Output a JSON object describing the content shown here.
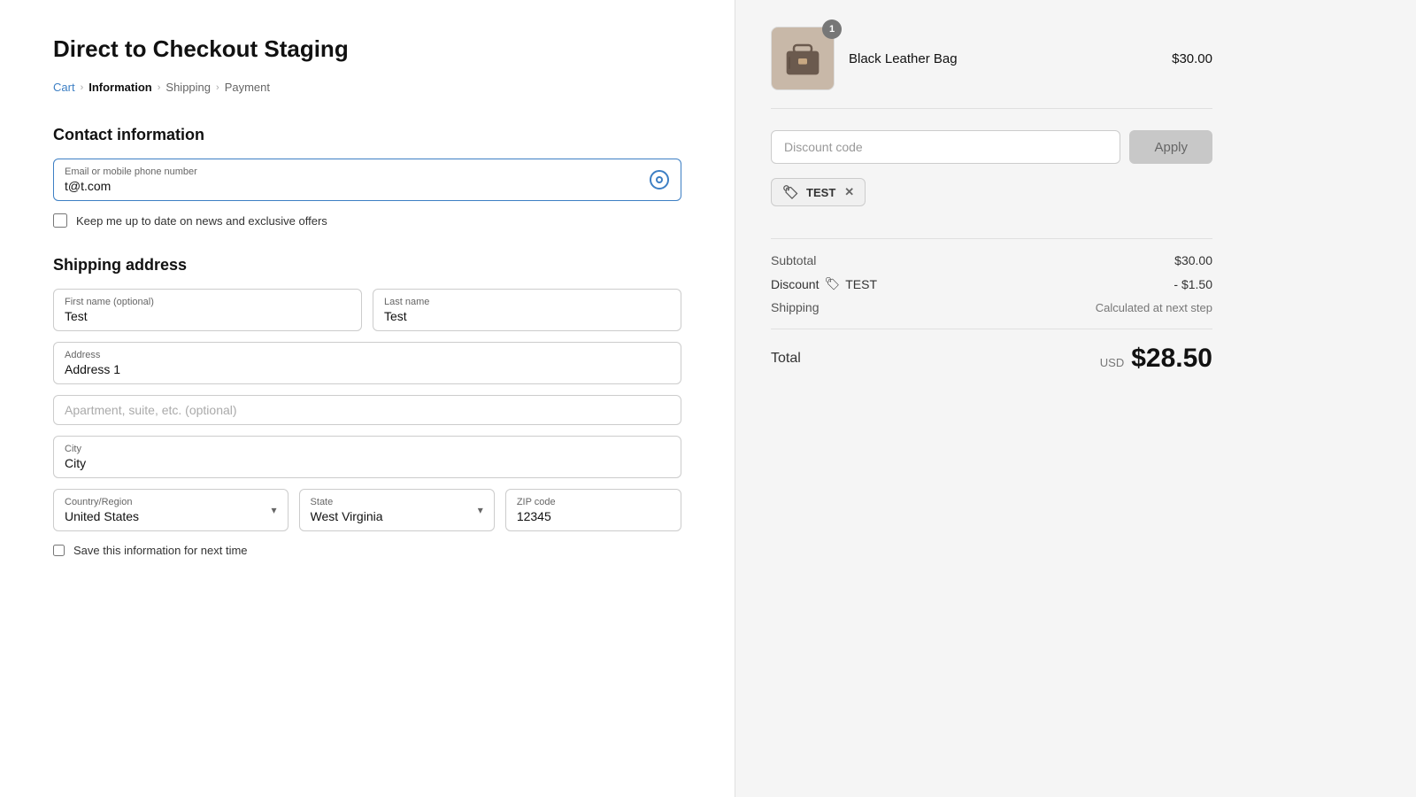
{
  "page": {
    "title": "Direct to Checkout Staging"
  },
  "breadcrumb": {
    "cart": "Cart",
    "information": "Information",
    "shipping": "Shipping",
    "payment": "Payment"
  },
  "contact": {
    "section_title": "Contact information",
    "email_label": "Email or mobile phone number",
    "email_value": "t@t.com",
    "email_placeholder": "Email or mobile phone number",
    "newsletter_label": "Keep me up to date on news and exclusive offers"
  },
  "shipping": {
    "section_title": "Shipping address",
    "first_name_label": "First name (optional)",
    "first_name_value": "Test",
    "last_name_label": "Last name",
    "last_name_value": "Test",
    "address_label": "Address",
    "address_value": "Address 1",
    "apartment_placeholder": "Apartment, suite, etc. (optional)",
    "city_label": "City",
    "city_value": "City",
    "country_label": "Country/Region",
    "country_value": "United States",
    "state_label": "State",
    "state_value": "West Virginia",
    "zip_label": "ZIP code",
    "zip_value": "12345",
    "save_label": "Save this information for next time"
  },
  "order_summary": {
    "product_name": "Black Leather Bag",
    "product_price": "$30.00",
    "product_quantity": "1",
    "discount_placeholder": "Discount code",
    "apply_label": "Apply",
    "coupon_code": "TEST",
    "subtotal_label": "Subtotal",
    "subtotal_value": "$30.00",
    "discount_label": "Discount",
    "discount_code_badge": "TEST",
    "discount_value": "- $1.50",
    "shipping_label": "Shipping",
    "shipping_value": "Calculated at next step",
    "total_label": "Total",
    "total_currency": "USD",
    "total_value": "$28.50"
  }
}
